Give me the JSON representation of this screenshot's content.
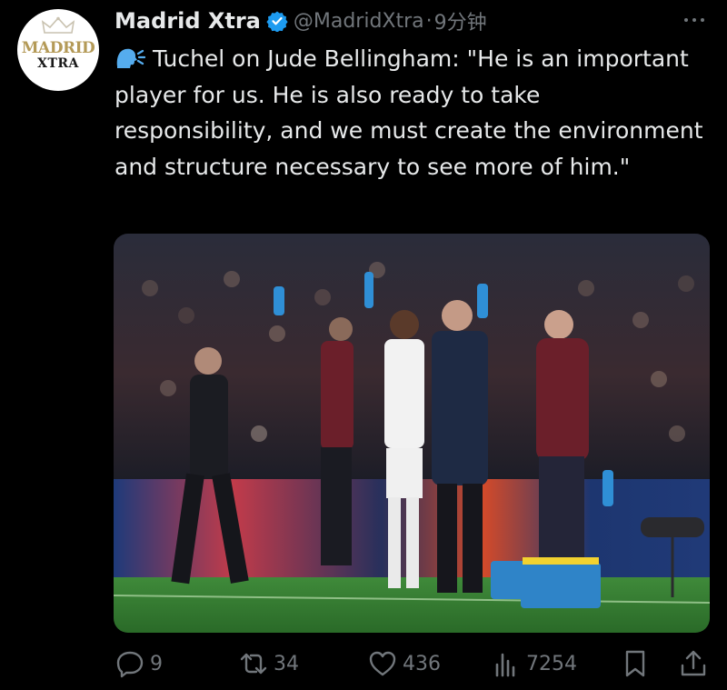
{
  "tweet": {
    "author": {
      "name": "Madrid Xtra",
      "handle": "@MadridXtra",
      "avatar_text_1": "MADRID",
      "avatar_text_2": "XTRA"
    },
    "separator": "·",
    "time": "9分钟",
    "text": "Tuchel on Jude Bellingham: \"He is an important player for us. He is also ready to take responsibility, and we must create the environment and structure necessary to see more of him.\"",
    "text_icon": "speaking-head-icon",
    "media_alt_icon": "photo"
  },
  "actions": {
    "replies": "9",
    "retweets": "34",
    "likes": "436",
    "views": "7254"
  },
  "colors": {
    "background": "#000000",
    "text": "#e7e9ea",
    "secondary": "#71767b",
    "verified": "#1d9bf0",
    "speaker_icon": "#55acee"
  }
}
